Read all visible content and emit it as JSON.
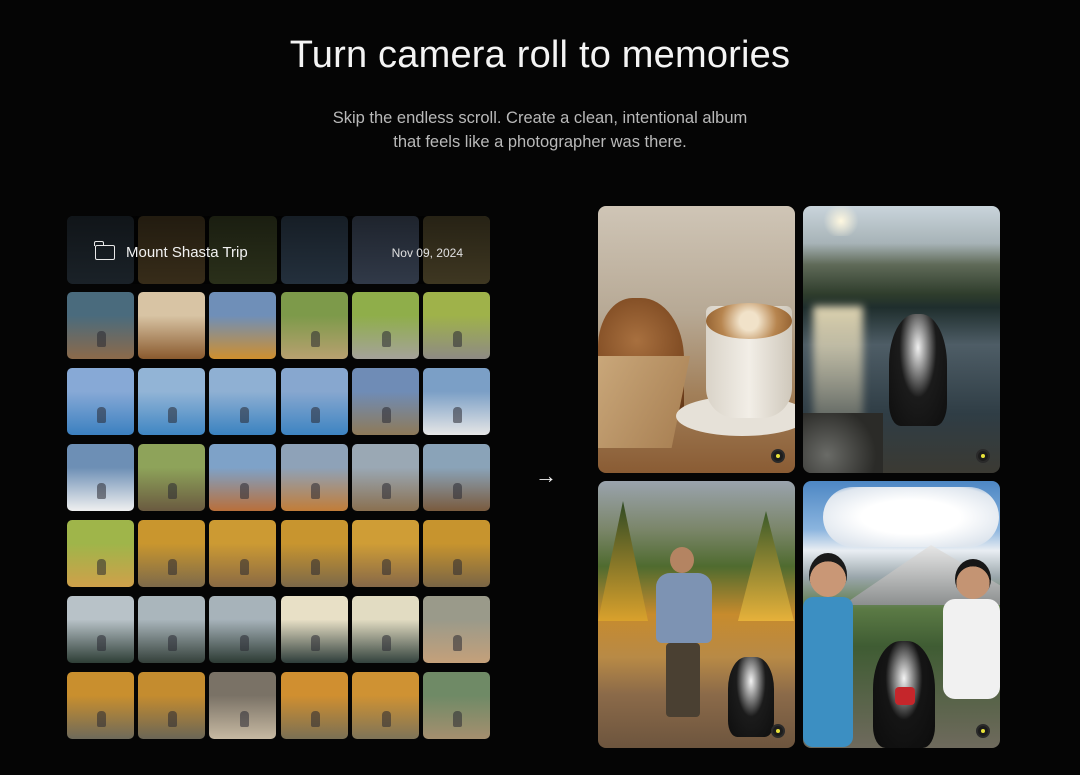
{
  "hero": {
    "title": "Turn camera roll to memories",
    "subtitle_line1": "Skip the endless scroll. Create a clean, intentional album",
    "subtitle_line2": "that feels like a photographer was there."
  },
  "camera_roll": {
    "album_name": "Mount Shasta Trip",
    "album_date": "Nov 09, 2024",
    "header_icon": "folder-icon",
    "thumbnails": [
      [
        "#4a6b7d",
        "#8c6a4a"
      ],
      [
        "#d8c4a4",
        "#8a5a2e"
      ],
      [
        "#6f8fb8",
        "#cf8f2e"
      ],
      [
        "#7d9a4a",
        "#b8a070"
      ],
      [
        "#8fae4a",
        "#a5a29a"
      ],
      [
        "#9fb24a",
        "#8e8a84"
      ],
      [
        "#87a9d6",
        "#3b80c0"
      ],
      [
        "#92b4d6",
        "#3f86c3"
      ],
      [
        "#8fb0d3",
        "#3a82c0"
      ],
      [
        "#87a7cf",
        "#3d84c2"
      ],
      [
        "#6f8cb6",
        "#8e7a58"
      ],
      [
        "#7b9fc6",
        "#e6e6e6"
      ],
      [
        "#6d8fb5",
        "#f0f0f0"
      ],
      [
        "#8ea35a",
        "#6a5a40"
      ],
      [
        "#7ea2c8",
        "#b96f3a"
      ],
      [
        "#8ea2b8",
        "#c27d38"
      ],
      [
        "#9aa8b4",
        "#8a7050"
      ],
      [
        "#8aa3b8",
        "#7a5b3e"
      ],
      [
        "#9fb54a",
        "#cfa04a"
      ],
      [
        "#c9962e",
        "#7d6a4a"
      ],
      [
        "#cc9a33",
        "#8a6a44"
      ],
      [
        "#c8952f",
        "#7c6848"
      ],
      [
        "#cf9d36",
        "#866848"
      ],
      [
        "#c7942e",
        "#7a6545"
      ],
      [
        "#b8c2c8",
        "#2e3e36"
      ],
      [
        "#aab6bc",
        "#34403a"
      ],
      [
        "#a7b3ba",
        "#2c3a33"
      ],
      [
        "#e8e0c6",
        "#2e3d3a"
      ],
      [
        "#e2dcc2",
        "#33423d"
      ],
      [
        "#9a9a8a",
        "#c4a07a"
      ],
      [
        "#c98f2e",
        "#6e6a5a"
      ],
      [
        "#c48c2f",
        "#6b6656"
      ],
      [
        "#7a7266",
        "#c7b9a2"
      ],
      [
        "#d08f30",
        "#7a7054"
      ],
      [
        "#cf9233",
        "#7e7458"
      ],
      [
        "#6f8a66",
        "#a58f6f"
      ]
    ]
  },
  "arrow": {
    "icon": "arrow-right-icon",
    "glyph": "→"
  },
  "curated_album": {
    "cards": [
      {
        "label": "muffin-and-latte",
        "icon": "selected-dot-icon"
      },
      {
        "label": "dog-in-lake",
        "icon": "selected-dot-icon"
      },
      {
        "label": "man-and-dog-on-trail",
        "icon": "selected-dot-icon"
      },
      {
        "label": "couple-with-dog",
        "icon": "selected-dot-icon"
      }
    ],
    "accent_color": "#e8e23a"
  }
}
